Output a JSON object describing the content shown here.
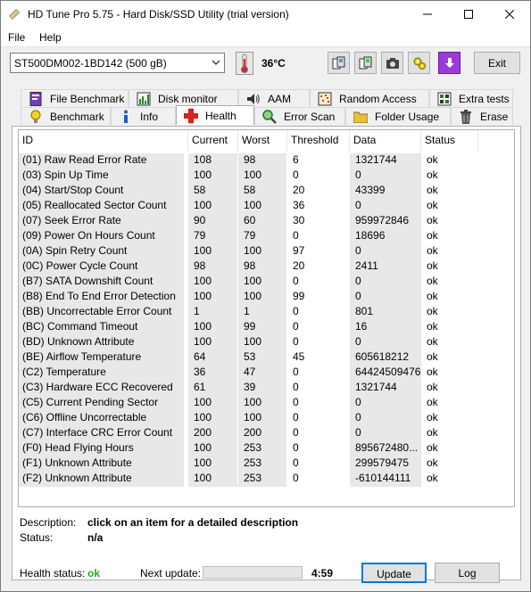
{
  "window": {
    "title": "HD Tune Pro 5.75 - Hard Disk/SSD Utility (trial version)",
    "controls": [
      "minimize",
      "maximize",
      "close"
    ]
  },
  "menu": {
    "file": "File",
    "help": "Help"
  },
  "toolbar": {
    "drive": "ST500DM002-1BD142 (500 gB)",
    "temperature": "36°C",
    "exit_label": "Exit"
  },
  "tabs_row1": [
    {
      "label": "File Benchmark",
      "icon": "file-benchmark-icon"
    },
    {
      "label": "Disk monitor",
      "icon": "disk-monitor-icon"
    },
    {
      "label": "AAM",
      "icon": "speaker-icon"
    },
    {
      "label": "Random Access",
      "icon": "random-access-icon"
    },
    {
      "label": "Extra tests",
      "icon": "extra-tests-icon"
    }
  ],
  "tabs_row2": [
    {
      "label": "Benchmark",
      "icon": "benchmark-icon"
    },
    {
      "label": "Info",
      "icon": "info-icon"
    },
    {
      "label": "Health",
      "icon": "health-cross-icon"
    },
    {
      "label": "Error Scan",
      "icon": "error-scan-icon"
    },
    {
      "label": "Folder Usage",
      "icon": "folder-icon"
    },
    {
      "label": "Erase",
      "icon": "trash-icon"
    }
  ],
  "table": {
    "headers": [
      "ID",
      "Current",
      "Worst",
      "Threshold",
      "Data",
      "Status"
    ],
    "rows": [
      [
        "(01) Raw Read Error Rate",
        "108",
        "98",
        "6",
        "1321744",
        "ok"
      ],
      [
        "(03) Spin Up Time",
        "100",
        "100",
        "0",
        "0",
        "ok"
      ],
      [
        "(04) Start/Stop Count",
        "58",
        "58",
        "20",
        "43399",
        "ok"
      ],
      [
        "(05) Reallocated Sector Count",
        "100",
        "100",
        "36",
        "0",
        "ok"
      ],
      [
        "(07) Seek Error Rate",
        "90",
        "60",
        "30",
        "959972846",
        "ok"
      ],
      [
        "(09) Power On Hours Count",
        "79",
        "79",
        "0",
        "18696",
        "ok"
      ],
      [
        "(0A) Spin Retry Count",
        "100",
        "100",
        "97",
        "0",
        "ok"
      ],
      [
        "(0C) Power Cycle Count",
        "98",
        "98",
        "20",
        "2411",
        "ok"
      ],
      [
        "(B7) SATA Downshift Count",
        "100",
        "100",
        "0",
        "0",
        "ok"
      ],
      [
        "(B8) End To End Error Detection",
        "100",
        "100",
        "99",
        "0",
        "ok"
      ],
      [
        "(BB) Uncorrectable Error Count",
        "1",
        "1",
        "0",
        "801",
        "ok"
      ],
      [
        "(BC) Command Timeout",
        "100",
        "99",
        "0",
        "16",
        "ok"
      ],
      [
        "(BD) Unknown Attribute",
        "100",
        "100",
        "0",
        "0",
        "ok"
      ],
      [
        "(BE) Airflow Temperature",
        "64",
        "53",
        "45",
        "605618212",
        "ok"
      ],
      [
        "(C2) Temperature",
        "36",
        "47",
        "0",
        "64424509476",
        "ok"
      ],
      [
        "(C3) Hardware ECC Recovered",
        "61",
        "39",
        "0",
        "1321744",
        "ok"
      ],
      [
        "(C5) Current Pending Sector",
        "100",
        "100",
        "0",
        "0",
        "ok"
      ],
      [
        "(C6) Offline Uncorrectable",
        "100",
        "100",
        "0",
        "0",
        "ok"
      ],
      [
        "(C7) Interface CRC Error Count",
        "200",
        "200",
        "0",
        "0",
        "ok"
      ],
      [
        "(F0) Head Flying Hours",
        "100",
        "253",
        "0",
        "895672480...",
        "ok"
      ],
      [
        "(F1) Unknown Attribute",
        "100",
        "253",
        "0",
        "299579475",
        "ok"
      ],
      [
        "(F2) Unknown Attribute",
        "100",
        "253",
        "0",
        "-610144111",
        "ok"
      ]
    ]
  },
  "details": {
    "description_label": "Description:",
    "description_value": "click on an item for a detailed description",
    "status_label": "Status:",
    "status_value": "n/a"
  },
  "footer": {
    "health_label": "Health status:",
    "health_value": "ok",
    "health_color": "#22aa22",
    "next_update_label": "Next update:",
    "countdown": "4:59",
    "update_label": "Update",
    "log_label": "Log"
  }
}
